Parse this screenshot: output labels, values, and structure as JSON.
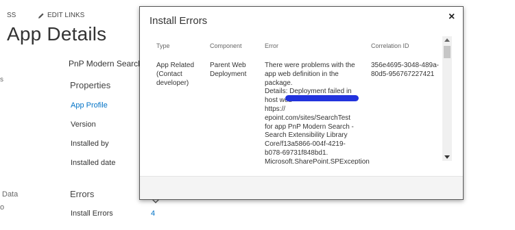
{
  "header": {
    "nav_prefix": "SS",
    "edit_links": "EDIT LINKS"
  },
  "page": {
    "title": "App Details"
  },
  "left_fragments": {
    "s": "s",
    "data": "Data",
    "o": "o"
  },
  "app": {
    "name": "PnP Modern Search -"
  },
  "properties": {
    "heading": "Properties",
    "app_profile": "App Profile",
    "version": "Version",
    "installed_by": "Installed by",
    "installed_date": "Installed date"
  },
  "errors": {
    "heading": "Errors",
    "install_errors_label": "Install Errors",
    "install_errors_count": "4"
  },
  "modal": {
    "title": "Install Errors",
    "close": "×",
    "columns": {
      "type": "Type",
      "component": "Component",
      "error": "Error",
      "correlation": "Correlation ID"
    },
    "row": {
      "type_lines": [
        "App Related",
        "(Contact",
        "developer)"
      ],
      "component_lines": [
        "Parent Web",
        "Deployment"
      ],
      "error_lines": [
        "There were problems with the",
        "app web definition in the",
        "package.",
        "Details: Deployment failed in",
        "host web",
        "https://",
        "epoint.com/sites/SearchTest",
        "for app PnP Modern Search -",
        "Search Extensibility Library",
        "Core/f13a5866-004f-4219-",
        "b078-69731f848bd1.",
        "Microsoft.SharePoint.SPException"
      ],
      "correlation_lines": [
        "356e4695-3048-489a-",
        "80d5-956767227421"
      ]
    }
  },
  "colors": {
    "link": "#0072c6",
    "redaction": "#2233dd",
    "modal_border": "#555555"
  }
}
